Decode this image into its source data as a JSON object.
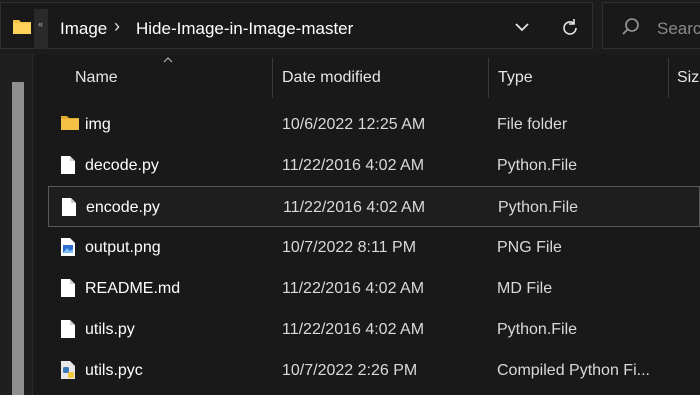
{
  "address": {
    "breadcrumb": [
      "Image",
      "Hide-Image-in-Image-master"
    ],
    "separator": "›",
    "overflow": "«"
  },
  "search": {
    "placeholder": "Searc"
  },
  "columns": {
    "name": "Name",
    "date": "Date modified",
    "type": "Type",
    "size": "Siz"
  },
  "files": [
    {
      "icon": "folder-icon",
      "name": "img",
      "date": "10/6/2022 12:25 AM",
      "type": "File folder"
    },
    {
      "icon": "file-icon",
      "name": "decode.py",
      "date": "11/22/2016 4:02 AM",
      "type": "Python.File"
    },
    {
      "icon": "file-icon",
      "name": "encode.py",
      "date": "11/22/2016 4:02 AM",
      "type": "Python.File"
    },
    {
      "icon": "image-file-icon",
      "name": "output.png",
      "date": "10/7/2022 8:11 PM",
      "type": "PNG File"
    },
    {
      "icon": "file-icon",
      "name": "README.md",
      "date": "11/22/2016 4:02 AM",
      "type": "MD File"
    },
    {
      "icon": "file-icon",
      "name": "utils.py",
      "date": "11/22/2016 4:02 AM",
      "type": "Python.File"
    },
    {
      "icon": "python-compiled-icon",
      "name": "utils.pyc",
      "date": "10/7/2022 2:26 PM",
      "type": "Compiled Python Fi..."
    }
  ],
  "colors": {
    "background": "#191919",
    "folder": "#f4c145",
    "selection_border": "#5a5a5a"
  }
}
